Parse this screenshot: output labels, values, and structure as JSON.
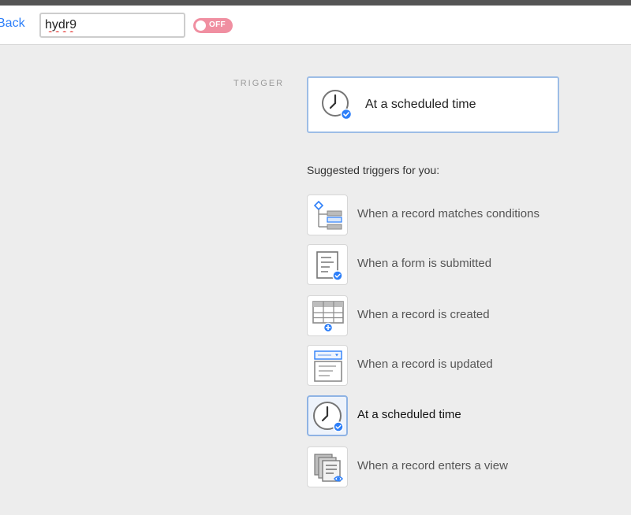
{
  "toolbar": {
    "back_label": "Back",
    "name_value": "hydr9",
    "toggle_label": "OFF"
  },
  "trigger": {
    "section_label": "TRIGGER",
    "selected_label": "At a scheduled time",
    "selected_icon": "clock-icon"
  },
  "suggestions": {
    "heading": "Suggested triggers for you:",
    "items": [
      {
        "label": "When a record matches conditions",
        "icon": "conditions-icon",
        "selected": false
      },
      {
        "label": "When a form is submitted",
        "icon": "form-icon",
        "selected": false
      },
      {
        "label": "When a record is created",
        "icon": "grid-plus-icon",
        "selected": false
      },
      {
        "label": "When a record is updated",
        "icon": "record-update-icon",
        "selected": false
      },
      {
        "label": "At a scheduled time",
        "icon": "clock-icon",
        "selected": true
      },
      {
        "label": "When a record enters a view",
        "icon": "view-eye-icon",
        "selected": false
      }
    ]
  },
  "colors": {
    "accent": "#2d7ff9",
    "toggle_off": "#f08fa1",
    "selected_border": "#9dbde6"
  }
}
